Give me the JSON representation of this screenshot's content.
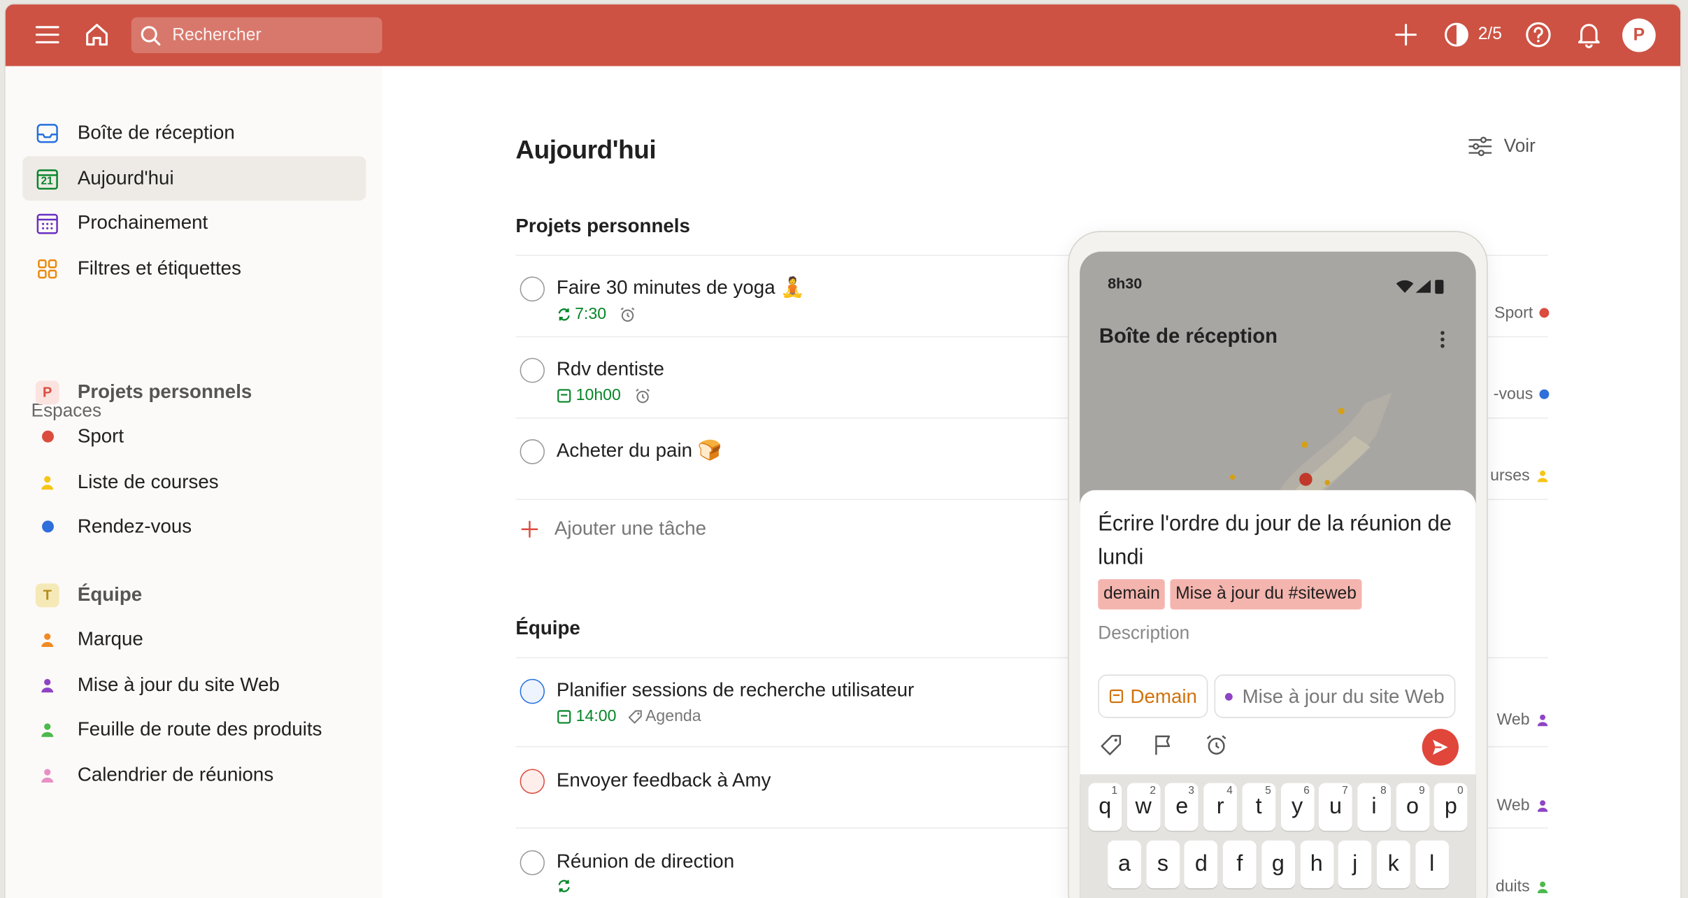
{
  "topbar": {
    "search_placeholder": "Rechercher",
    "karma_count": "2/5",
    "avatar_initial": "P",
    "bar_color": "#cd5243"
  },
  "sidebar": {
    "nav": [
      {
        "label": "Boîte de réception",
        "icon": "inbox-icon"
      },
      {
        "label": "Aujourd'hui",
        "icon": "calendar-today-icon",
        "date_number": "21"
      },
      {
        "label": "Prochainement",
        "icon": "calendar-grid-icon"
      },
      {
        "label": "Filtres et étiquettes",
        "icon": "filters-icon"
      }
    ],
    "spaces_heading": "Espaces",
    "personal": {
      "badge": "P",
      "label": "Projets personnels",
      "projects": [
        {
          "label": "Sport",
          "color": "#db4c3f",
          "icon": "dot"
        },
        {
          "label": "Liste de courses",
          "color": "#f5c518",
          "icon": "person"
        },
        {
          "label": "Rendez-vous",
          "color": "#2f6fdb",
          "icon": "dot"
        }
      ]
    },
    "team": {
      "badge": "T",
      "label": "Équipe",
      "projects": [
        {
          "label": "Marque",
          "color": "#f08a24",
          "icon": "person"
        },
        {
          "label": "Mise à jour du site Web",
          "color": "#8e44c4",
          "icon": "person"
        },
        {
          "label": "Feuille de route des produits",
          "color": "#4cb94c",
          "icon": "person"
        },
        {
          "label": "Calendrier de réunions",
          "color": "#e88fc4",
          "icon": "person"
        }
      ]
    }
  },
  "main": {
    "title": "Aujourd'hui",
    "view_label": "Voir",
    "personal_section": {
      "title": "Projets personnels",
      "tasks": [
        {
          "title": "Faire 30 minutes de yoga 🧘",
          "time": "7:30",
          "project": "Sport"
        },
        {
          "title": "Rdv dentiste",
          "time": "10h00",
          "project": "-vous"
        },
        {
          "title": "Acheter du pain 🍞",
          "time": "",
          "project": "urses"
        }
      ],
      "add_task": "Ajouter une tâche"
    },
    "team_section": {
      "title": "Équipe",
      "tasks": [
        {
          "title": "Planifier sessions de recherche utilisateur",
          "time": "14:00",
          "label": "Agenda",
          "project": "Web"
        },
        {
          "title": "Envoyer feedback à Amy",
          "time": "",
          "project": "Web"
        },
        {
          "title": "Réunion de direction",
          "time": "",
          "project": "duits"
        }
      ]
    }
  },
  "phone": {
    "status_time": "8h30",
    "title": "Boîte de réception",
    "quick_add": {
      "task_text": "Écrire l'ordre du jour de la réunion de lundi",
      "chips": [
        "demain",
        "Mise à jour du #siteweb"
      ],
      "description_placeholder": "Description",
      "date_pill": "Demain",
      "project_pill": "Mise à jour du site Web"
    },
    "keyboard": {
      "row1": [
        {
          "k": "q",
          "n": "1"
        },
        {
          "k": "w",
          "n": "2"
        },
        {
          "k": "e",
          "n": "3"
        },
        {
          "k": "r",
          "n": "4"
        },
        {
          "k": "t",
          "n": "5"
        },
        {
          "k": "y",
          "n": "6"
        },
        {
          "k": "u",
          "n": "7"
        },
        {
          "k": "i",
          "n": "8"
        },
        {
          "k": "o",
          "n": "9"
        },
        {
          "k": "p",
          "n": "0"
        }
      ],
      "row2": [
        "a",
        "s",
        "d",
        "f",
        "g",
        "h",
        "j",
        "k",
        "l"
      ]
    }
  }
}
